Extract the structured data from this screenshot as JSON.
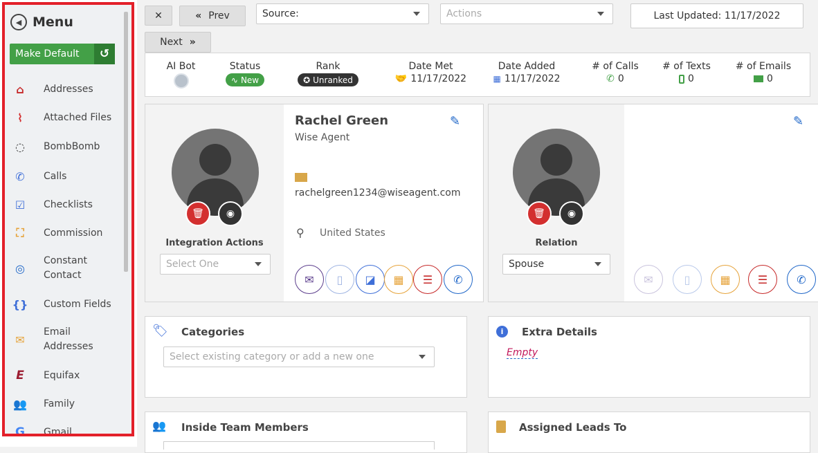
{
  "sidebar": {
    "title": "Menu",
    "make_default": "Make Default",
    "items": [
      {
        "label": "Addresses",
        "icon": "home-icon",
        "color": "#c62828"
      },
      {
        "label": "Attached Files",
        "icon": "paperclip-icon",
        "color": "#d32f2f"
      },
      {
        "label": "BombBomb",
        "icon": "bombbomb-icon",
        "color": "#333333"
      },
      {
        "label": "Calls",
        "icon": "phone-icon",
        "color": "#3f6fd8"
      },
      {
        "label": "Checklists",
        "icon": "checkbox-icon",
        "color": "#3f6fd8"
      },
      {
        "label": "Commission",
        "icon": "chart-icon",
        "color": "#e6a33a"
      },
      {
        "label": "Constant Contact",
        "icon": "constant-contact-icon",
        "color": "#1e66c8"
      },
      {
        "label": "Custom Fields",
        "icon": "braces-icon",
        "color": "#3f6fd8"
      },
      {
        "label": "Email Addresses",
        "icon": "envelope-open-icon",
        "color": "#e6a33a"
      },
      {
        "label": "Equifax",
        "icon": "equifax-icon",
        "color": "#9b1b30"
      },
      {
        "label": "Family",
        "icon": "users-icon",
        "color": "#5c5ca8"
      },
      {
        "label": "Gmail",
        "icon": "google-icon",
        "color": "#4285f4"
      }
    ]
  },
  "toolbar": {
    "close": "✕",
    "prev": "Prev",
    "next": "Next",
    "source_label": "Source:",
    "actions_placeholder": "Actions",
    "last_updated": "Last Updated: 11/17/2022"
  },
  "stats": {
    "ai_bot": "AI Bot",
    "status_label": "Status",
    "status_value": "New",
    "rank_label": "Rank",
    "rank_value": "Unranked",
    "date_met_label": "Date Met",
    "date_met_value": "11/17/2022",
    "date_added_label": "Date Added",
    "date_added_value": "11/17/2022",
    "calls_label": "# of Calls",
    "calls_value": "0",
    "texts_label": "# of Texts",
    "texts_value": "0",
    "emails_label": "# of Emails",
    "emails_value": "0"
  },
  "contact": {
    "name": "Rachel Green",
    "company": "Wise Agent",
    "email": "rachelgreen1234@wiseagent.com",
    "location": "United States",
    "integration_label": "Integration Actions",
    "integration_placeholder": "Select One"
  },
  "relation": {
    "label": "Relation",
    "value": "Spouse"
  },
  "categories": {
    "title": "Categories",
    "placeholder": "Select existing category or add a new one"
  },
  "extra_details": {
    "title": "Extra Details",
    "value": "Empty"
  },
  "inside_team": {
    "title": "Inside Team Members"
  },
  "assigned_leads": {
    "title": "Assigned Leads To"
  }
}
